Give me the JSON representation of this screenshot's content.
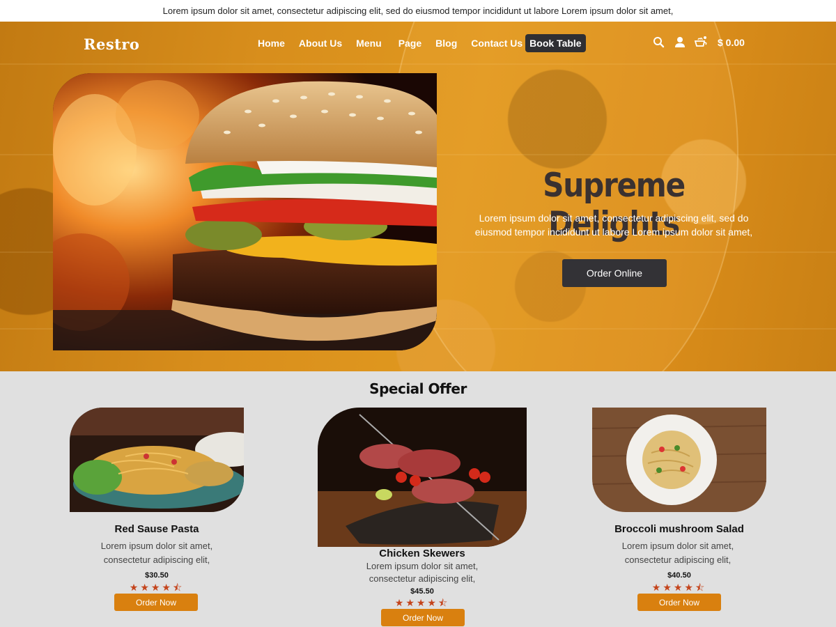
{
  "topbar": {
    "text": "Lorem ipsum dolor sit amet, consectetur adipiscing elit, sed do eiusmod tempor incididunt ut labore Lorem ipsum dolor sit amet,"
  },
  "header": {
    "logo": "Restro",
    "nav": [
      "Home",
      "About Us",
      "Menu",
      "Page",
      "Blog",
      "Contact Us"
    ],
    "cta": "Book Table",
    "icons": [
      "search-icon",
      "user-icon",
      "cart-icon"
    ],
    "cart_total": "$ 0.00"
  },
  "hero": {
    "title": "Supreme Delights",
    "description": "Lorem ipsum dolor sit amet, consectetur adipiscing elit, sed do eiusmod tempor incididunt ut labore Lorem ipsum dolor sit amet,",
    "button": "Order Online"
  },
  "special_offer": {
    "title": "Special Offer",
    "items": [
      {
        "name": "Red Sause Pasta",
        "description": "Lorem ipsum dolor sit amet, consectetur adipiscing elit,",
        "price": "$30.50",
        "rating": 4.5,
        "stars": "★★★★⯪",
        "button": "Order Now"
      },
      {
        "name": "Chicken Skewers",
        "description": "Lorem ipsum dolor sit amet, consectetur adipiscing elit,",
        "price": "$45.50",
        "rating": 4.5,
        "stars": "★★★★⯪",
        "button": "Order Now"
      },
      {
        "name": "Broccoli mushroom Salad",
        "description": "Lorem ipsum dolor sit amet, consectetur adipiscing elit,",
        "price": "$40.50",
        "rating": 4.5,
        "stars": "★★★★⯪",
        "button": "Order Now"
      }
    ]
  },
  "colors": {
    "accent": "#d9800f",
    "dark": "#333236",
    "hero_orange": "#dd921e",
    "star": "#c4441c",
    "section_bg": "#e0e0e0"
  }
}
